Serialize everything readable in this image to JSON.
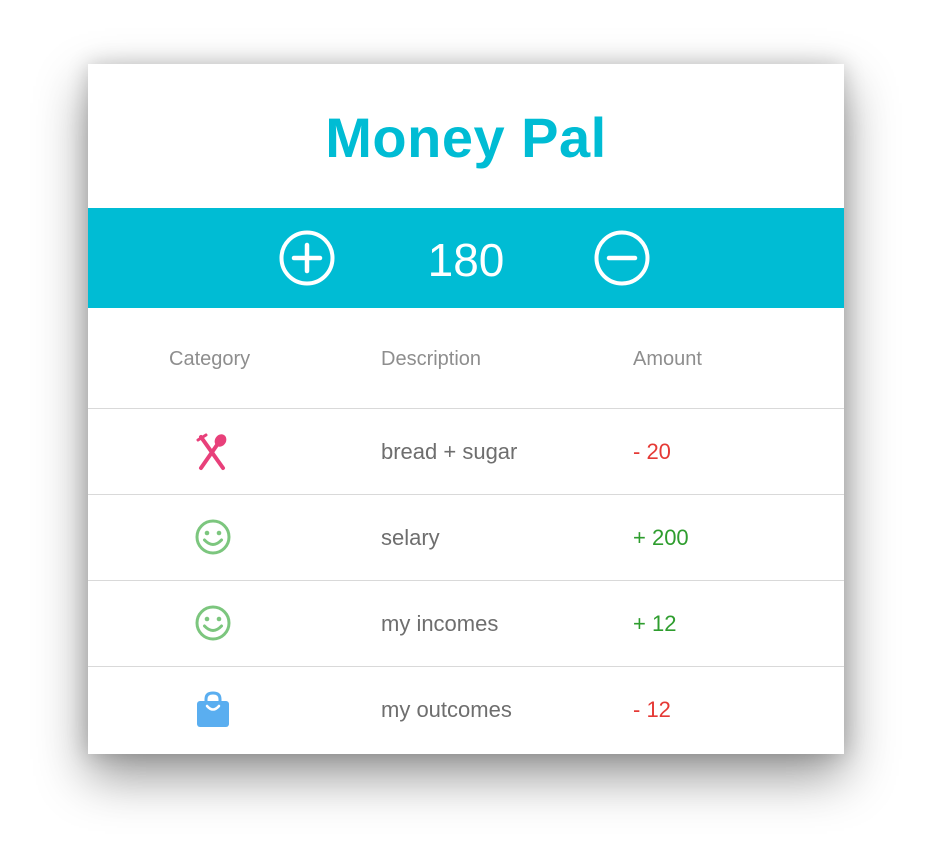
{
  "app": {
    "title": "Money Pal"
  },
  "balance": {
    "value": "180",
    "add_icon": "plus-circle-icon",
    "subtract_icon": "minus-circle-icon"
  },
  "table": {
    "headers": {
      "category": "Category",
      "description": "Description",
      "amount": "Amount"
    },
    "rows": [
      {
        "icon": "fork-spoon-icon",
        "icon_color": "#e8407a",
        "description": "bread + sugar",
        "amount": "- 20",
        "amount_color": "#e53935"
      },
      {
        "icon": "smiley-icon",
        "icon_color": "#7cc67e",
        "description": "selary",
        "amount": "+ 200",
        "amount_color": "#2e9d2e"
      },
      {
        "icon": "smiley-icon",
        "icon_color": "#7cc67e",
        "description": "my incomes",
        "amount": "+ 12",
        "amount_color": "#2e9d2e"
      },
      {
        "icon": "shopping-bag-icon",
        "icon_color": "#5aaef0",
        "description": "my outcomes",
        "amount": "- 12",
        "amount_color": "#e53935"
      }
    ]
  },
  "colors": {
    "accent": "#00bcd4",
    "expense": "#e53935",
    "income": "#2e9d2e"
  }
}
